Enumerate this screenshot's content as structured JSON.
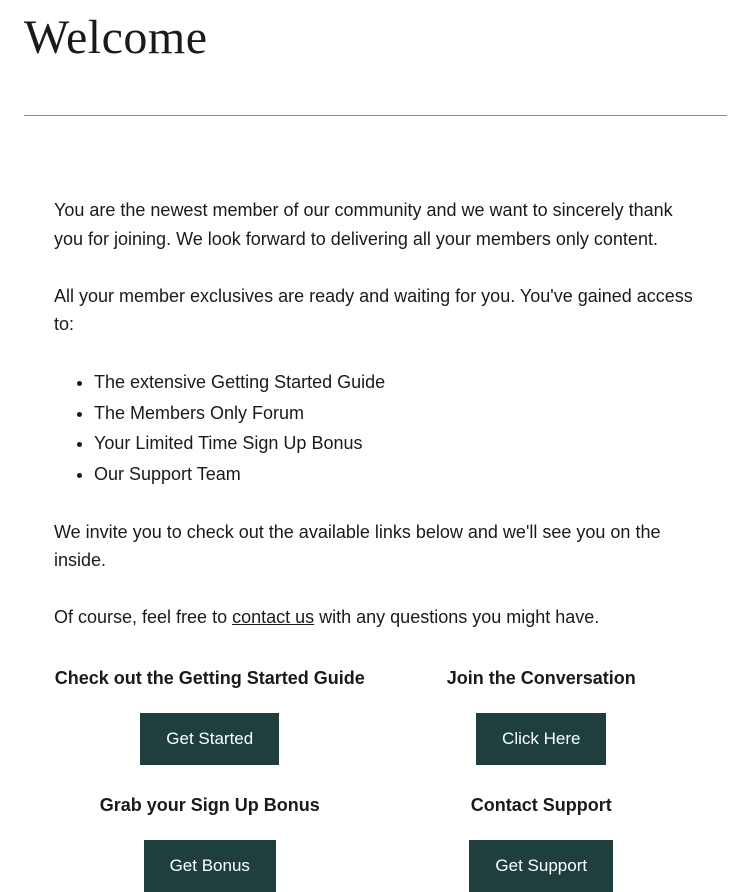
{
  "title": "Welcome",
  "intro_p1": "You are the newest member of our community and we want to sincerely thank you for joining. We look forward to delivering all your members only content.",
  "intro_p2": "All your member exclusives are ready and waiting for you. You've gained access to:",
  "bullets": [
    "The extensive Getting Started Guide",
    "The Members Only Forum",
    "Your Limited Time Sign Up Bonus",
    "Our Support Team"
  ],
  "invite_text": "We invite you to check out the available links below and we'll see you on the inside.",
  "contact_prefix": "Of course, feel free to ",
  "contact_link_text": "contact us",
  "contact_suffix": " with any questions you might have.",
  "cta": [
    {
      "heading": "Check out the Getting Started Guide",
      "button": "Get Started"
    },
    {
      "heading": "Join the Conversation",
      "button": "Click Here"
    },
    {
      "heading": "Grab your Sign Up Bonus",
      "button": "Get Bonus"
    },
    {
      "heading": "Contact Support",
      "button": "Get Support"
    }
  ]
}
